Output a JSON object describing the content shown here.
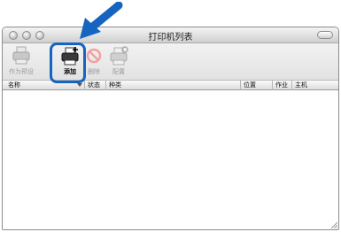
{
  "window": {
    "title": "打印机列表"
  },
  "toolbar": {
    "buttons": [
      {
        "label": "作为预设",
        "icon": "printer-default-icon",
        "enabled": false
      },
      {
        "label": "添加",
        "icon": "printer-add-icon",
        "enabled": true
      },
      {
        "label": "删除",
        "icon": "delete-icon",
        "enabled": false
      },
      {
        "label": "配置",
        "icon": "printer-configure-icon",
        "enabled": false
      }
    ]
  },
  "list": {
    "columns": [
      "名称",
      "状态",
      "种类",
      "位置",
      "作业",
      "主机"
    ],
    "sort_column": "名称",
    "rows": []
  },
  "colors": {
    "annotation": "#1565c0"
  }
}
